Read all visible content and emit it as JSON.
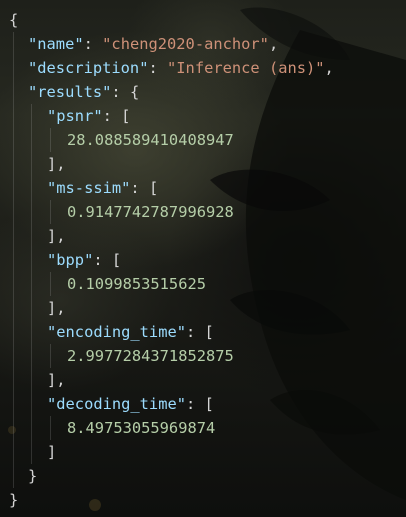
{
  "file": {
    "open_brace": "{",
    "close_brace": "}",
    "name_key": "\"name\"",
    "name_value": "\"cheng2020-anchor\"",
    "description_key": "\"description\"",
    "description_value": "\"Inference (ans)\"",
    "results_key": "\"results\"",
    "results_open": "{",
    "results_close": "}",
    "colon": ": ",
    "comma": ",",
    "bracket_open": "[",
    "bracket_close": "]",
    "bracket_close_comma": "],",
    "metrics": [
      {
        "key": "\"psnr\"",
        "value": "28.088589410408947"
      },
      {
        "key": "\"ms-ssim\"",
        "value": "0.9147742787996928"
      },
      {
        "key": "\"bpp\"",
        "value": "0.1099853515625"
      },
      {
        "key": "\"encoding_time\"",
        "value": "2.9977284371852875"
      },
      {
        "key": "\"decoding_time\"",
        "value": "8.49753055969874"
      }
    ]
  },
  "colors": {
    "key": "#9cdcfe",
    "string": "#ce9178",
    "number": "#b5cea8",
    "punctuation": "#d4d4d4"
  }
}
